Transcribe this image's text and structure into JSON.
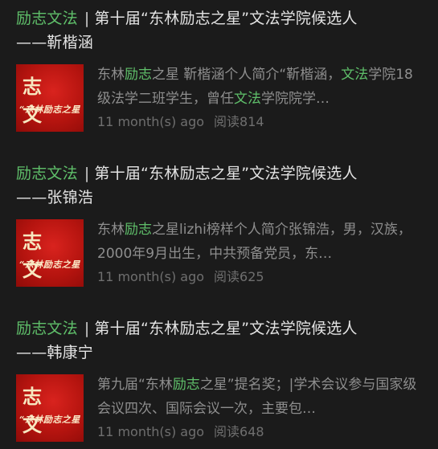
{
  "posts": [
    {
      "account": "励志文法",
      "title_line1": "第十届“东林励志之星”文法学院候选人",
      "title_line2": "——靳楷涵",
      "thumb": {
        "big": "志 文",
        "small": "“东林励志之星"
      },
      "excerpt": {
        "p1": "东林",
        "k1": "励志",
        "p2": "之星 靳楷涵个人简介“靳楷涵，",
        "k2": "文法",
        "p3": "学院18级法学二班学生，曾任",
        "k3": "文法",
        "p4": "学院院学…"
      },
      "age": "11 month(s) ago",
      "reads": "阅读814"
    },
    {
      "account": "励志文法",
      "title_line1": "第十届“东林励志之星”文法学院候选人",
      "title_line2": "——张锦浩",
      "thumb": {
        "big": "志 文",
        "small": "“东林励志之星"
      },
      "excerpt": {
        "p1": "东林",
        "k1": "励志",
        "p2": "之星lizhi榜样个人简介张锦浩，男，汉族，2000年9月出生，中共预备党员，东…",
        "k2": "",
        "p3": "",
        "k3": "",
        "p4": ""
      },
      "age": "11 month(s) ago",
      "reads": "阅读625"
    },
    {
      "account": "励志文法",
      "title_line1": "第十届“东林励志之星”文法学院候选人",
      "title_line2": "——韩康宁",
      "thumb": {
        "big": "志 文",
        "small": "“东林励志之星"
      },
      "excerpt": {
        "p1": "第九届“东林",
        "k1": "励志",
        "p2": "之星”提名奖；|学术会议参与国家级会议四次、国际会议一次，主要包…",
        "k2": "",
        "p3": "",
        "k3": "",
        "p4": ""
      },
      "age": "11 month(s) ago",
      "reads": "阅读648"
    }
  ],
  "colors": {
    "highlight": "#5fbf6a",
    "background": "#191919",
    "thumb_red": "#c8170f"
  }
}
